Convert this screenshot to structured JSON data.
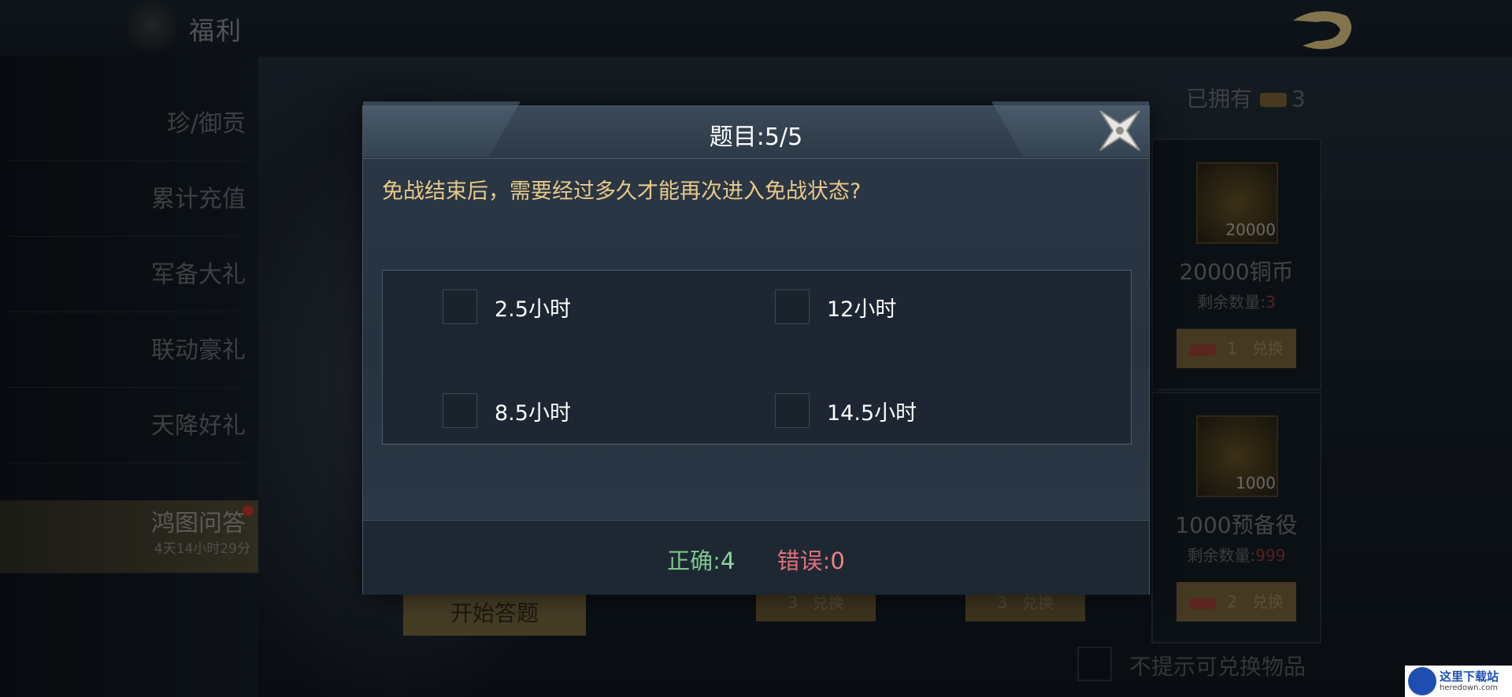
{
  "header": {
    "title": "福利"
  },
  "sidebar": {
    "items": [
      {
        "label": "珍/御贡"
      },
      {
        "label": "累计充值"
      },
      {
        "label": "军备大礼"
      },
      {
        "label": "联动豪礼"
      },
      {
        "label": "天降好礼"
      },
      {
        "label": "鸿图问答",
        "sub": "4天14小时29分",
        "active": true
      }
    ]
  },
  "shop": {
    "owned_label": "已拥有",
    "owned_count": "3",
    "cards": [
      {
        "qty": "20000",
        "name": "20000铜币",
        "remain_label": "剩余数量:",
        "remain_value": "3",
        "cost": "1",
        "redeem_label": "兑换"
      },
      {
        "qty": "1000",
        "name": "1000预备役",
        "remain_label": "剩余数量:",
        "remain_value": "999",
        "cost": "2",
        "redeem_label": "兑换"
      }
    ],
    "bottom_buttons": [
      {
        "cost": "3",
        "label": "兑换"
      },
      {
        "cost": "3",
        "label": "兑换"
      }
    ],
    "start_button": "开始答题",
    "hint_text": "不提示可兑换物品"
  },
  "quiz": {
    "title": "题目:5/5",
    "question": "免战结束后，需要经过多久才能再次进入免战状态?",
    "options": [
      "2.5小时",
      "12小时",
      "8.5小时",
      "14.5小时"
    ],
    "correct_label": "正确:",
    "correct_value": "4",
    "wrong_label": "错误:",
    "wrong_value": "0"
  },
  "watermark": {
    "line1": "这里下载站",
    "line2": "heredown.com"
  },
  "colors": {
    "question": "#e8c98a",
    "correct": "#7cc48d",
    "wrong": "#e0707a",
    "dialog_bg": "#27323f"
  }
}
